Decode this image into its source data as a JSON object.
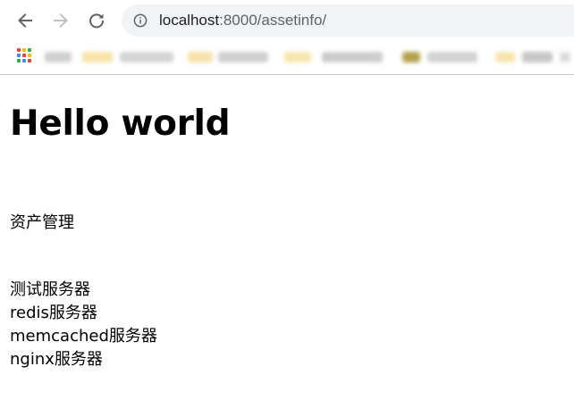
{
  "browser": {
    "nav": {
      "back_icon": "arrow-left-icon",
      "forward_icon": "arrow-right-icon",
      "reload_icon": "reload-icon",
      "info_icon": "info-circle-icon"
    },
    "address_bar": {
      "host": "localhost",
      "port_path": ":8000/assetinfo/"
    },
    "bookmarks_bar": {
      "apps_icon": "apps-grid-icon",
      "apps_colors": [
        "#ea4335",
        "#fbbc05",
        "#34a853",
        "#4285f4"
      ]
    }
  },
  "page": {
    "heading": "Hello world",
    "section_label": "资产管理",
    "servers": [
      "测试服务器",
      "redis服务器",
      "memcached服务器",
      "nginx服务器"
    ]
  }
}
